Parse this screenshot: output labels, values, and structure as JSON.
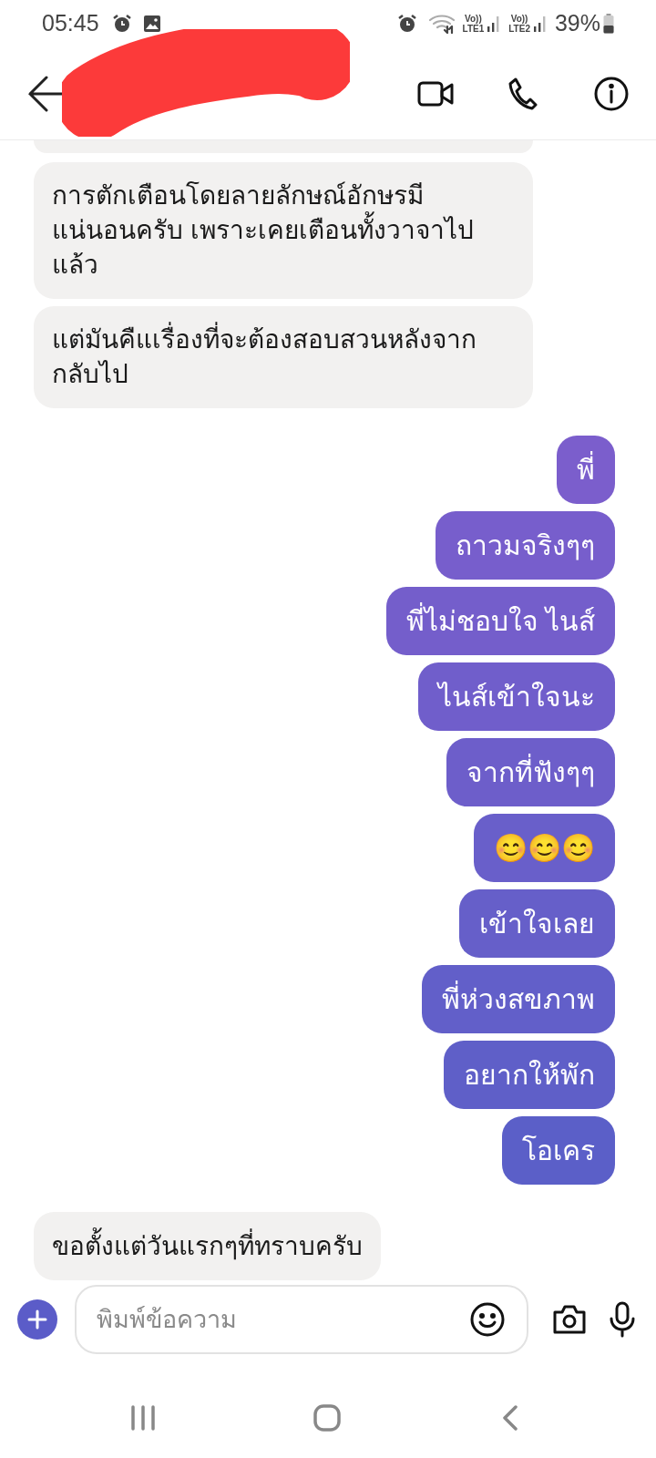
{
  "status_bar": {
    "time": "05:45",
    "sims": [
      {
        "top": "Vo))",
        "bottom": "LTE1"
      },
      {
        "top": "Vo))",
        "bottom": "LTE2"
      }
    ],
    "battery": "39%"
  },
  "messages": [
    {
      "outgoing": false,
      "text": "การตักเตือนโดยลายลักษณ์อักษรมี\nแน่นอนครับ เพราะเคยเตือนทั้งวาจาไป\nแล้ว"
    },
    {
      "outgoing": false,
      "text": "แต่มันคืแเรื่องที่จะต้องสอบสวนหลังจาก\nกลับไป"
    },
    {
      "outgoing": true,
      "text": "พี่"
    },
    {
      "outgoing": true,
      "text": "ถาวมจริงๆๆ"
    },
    {
      "outgoing": true,
      "text": "พี่ไม่ชอบใจ ไนส์"
    },
    {
      "outgoing": true,
      "text": "ไนส์เข้าใจนะ"
    },
    {
      "outgoing": true,
      "text": "จากที่ฟังๆๆ"
    },
    {
      "outgoing": true,
      "text": "😊😊😊"
    },
    {
      "outgoing": true,
      "text": "เข้าใจเลย"
    },
    {
      "outgoing": true,
      "text": "พี่ห่วงสขภาพ"
    },
    {
      "outgoing": true,
      "text": "อยากให้พัก"
    },
    {
      "outgoing": true,
      "text": "โอเคร"
    },
    {
      "outgoing": false,
      "text": "ขอตั้งแต่วันแรกๆที่ทราบครับ"
    }
  ],
  "composer": {
    "placeholder": "พิมพ์ข้อความ"
  }
}
